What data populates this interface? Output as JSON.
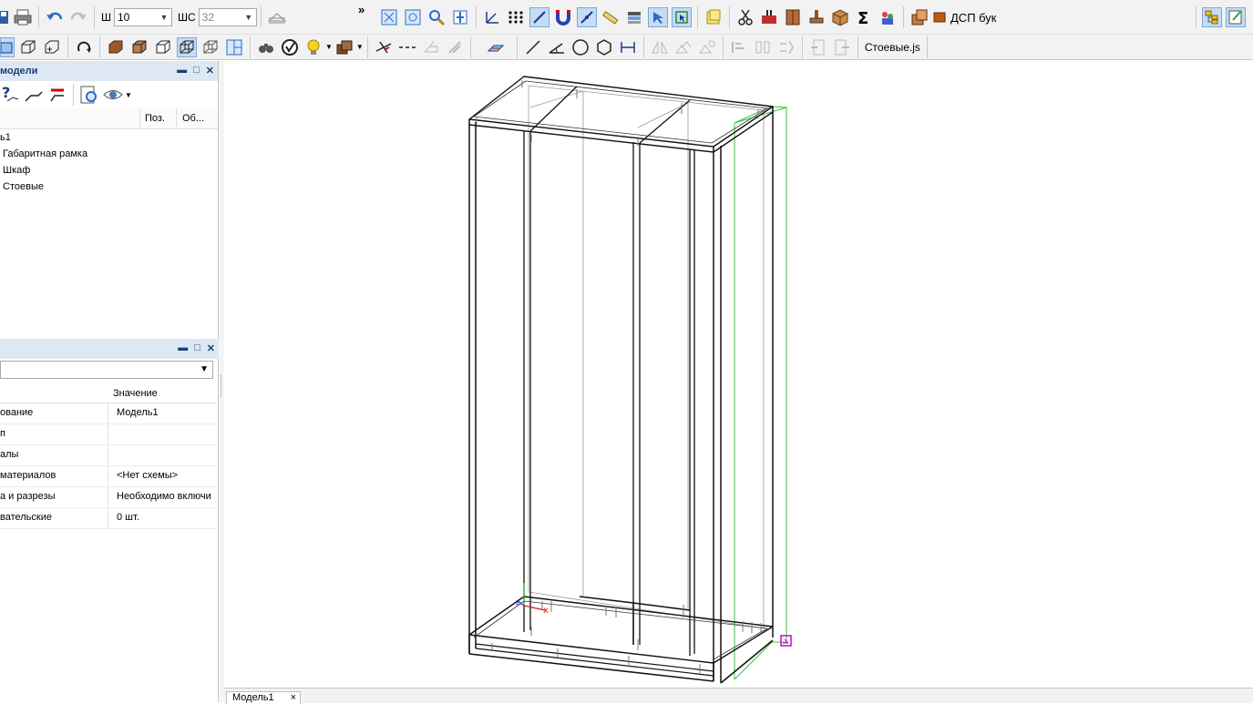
{
  "toolbar1": {
    "width_label": "Ш",
    "width_value": "10",
    "ws_label": "ШС",
    "ws_value": "32",
    "material_label": "ДСП бук",
    "overflow_glyph": "»"
  },
  "toolbar2": {
    "script_label": "Стоевые.js"
  },
  "model_panel": {
    "title": "модели",
    "col_pos": "Поз.",
    "col_ob": "Об...",
    "tree": [
      {
        "label": "ь1",
        "indent": 0
      },
      {
        "label": "Габаритная рамка",
        "indent": 1
      },
      {
        "label": "Шкаф",
        "indent": 1
      },
      {
        "label": "Стоевые",
        "indent": 1
      }
    ]
  },
  "props_panel": {
    "col_value": "Значение",
    "rows": [
      {
        "name": "ование",
        "value": "Модель1"
      },
      {
        "name": "п",
        "value": ""
      },
      {
        "name": "алы",
        "value": ""
      },
      {
        "name": "материалов",
        "value": "<Нет схемы>"
      },
      {
        "name": "а и разрезы",
        "value": "Необходимо включи"
      },
      {
        "name": "вательские",
        "value": "0 шт."
      }
    ]
  },
  "tabs": {
    "model_tab": "Модель1",
    "close_glyph": "×"
  },
  "colors": {
    "selection_frame": "#3cc23c",
    "origin_marker": "#d000d0",
    "panel_header": "#dde8f4"
  }
}
